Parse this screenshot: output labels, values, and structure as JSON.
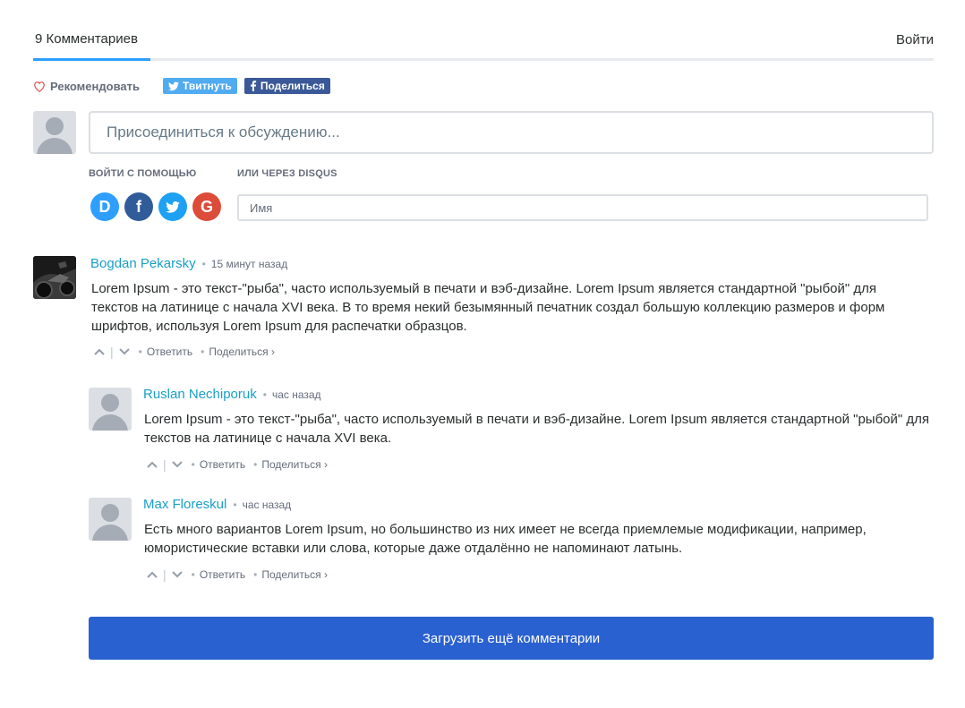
{
  "header": {
    "comment_count_label": "9 Комментариев",
    "login_label": "Войти"
  },
  "actions": {
    "recommend_label": "Рекомендовать",
    "tweet_label": "Твитнуть",
    "share_label": "Поделиться"
  },
  "compose": {
    "placeholder": "Присоединиться к обсуждению...",
    "login_with_label": "ВОЙТИ С ПОМОЩЬЮ",
    "or_disqus_label": "ИЛИ ЧЕРЕЗ DISQUS",
    "name_placeholder": "Имя",
    "providers": [
      {
        "name": "disqus",
        "glyph": "D",
        "color": "#2e9fff"
      },
      {
        "name": "facebook",
        "glyph": "f",
        "color": "#305c99"
      },
      {
        "name": "twitter",
        "glyph": "twitter-bird",
        "color": "#1da1f2"
      },
      {
        "name": "google",
        "glyph": "G",
        "color": "#dd4b39"
      }
    ]
  },
  "comments": [
    {
      "author": "Bogdan Pekarsky",
      "time": "15 минут назад",
      "text": "Lorem Ipsum - это текст-\"рыба\", часто используемый в печати и вэб-дизайне. Lorem Ipsum является стандартной \"рыбой\" для текстов на латинице с начала XVI века. В то время некий безымянный печатник создал большую коллекцию размеров и форм шрифтов, используя Lorem Ipsum для распечатки образцов.",
      "reply_label": "Ответить",
      "share_label": "Поделиться ›"
    },
    {
      "author": "Ruslan Nechiporuk",
      "time": "час назад",
      "text": "Lorem Ipsum - это текст-\"рыба\", часто используемый в печати и вэб-дизайне. Lorem Ipsum является стандартной \"рыбой\" для текстов на латинице с начала XVI века.",
      "reply_label": "Ответить",
      "share_label": "Поделиться ›"
    },
    {
      "author": "Max Floreskul",
      "time": "час назад",
      "text": "Есть много вариантов Lorem Ipsum, но большинство из них имеет не всегда приемлемые модификации, например, юмористические вставки или слова, которые даже отдалённо не напоминают латынь.",
      "reply_label": "Ответить",
      "share_label": "Поделиться ›"
    }
  ],
  "load_more_label": "Загрузить ещё комментарии",
  "colors": {
    "accent": "#2e9fff",
    "author_link": "#1a9fc7",
    "load_more_bg": "#2a61d0",
    "twitter": "#50abf1",
    "facebook": "#3b5998"
  }
}
